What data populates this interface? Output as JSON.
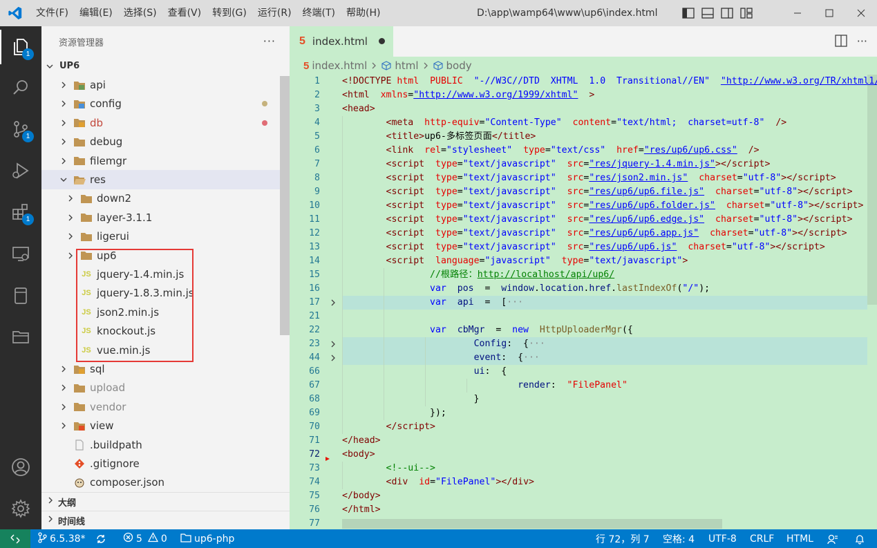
{
  "titlebar": {
    "menu": [
      "文件(F)",
      "编辑(E)",
      "选择(S)",
      "查看(V)",
      "转到(G)",
      "运行(R)",
      "终端(T)",
      "帮助(H)"
    ],
    "window_title": "D:\\app\\wamp64\\www\\up6\\index.html"
  },
  "activity": {
    "explorer_badge": "1",
    "scm_badge": "1",
    "extensions_badge": "1"
  },
  "sidebar": {
    "title": "资源管理器",
    "more": "···",
    "root": "UP6",
    "items": [
      {
        "label": "api",
        "depth": 1,
        "kind": "folder-special",
        "icon_color": "#6a9955"
      },
      {
        "label": "config",
        "depth": 1,
        "kind": "folder-special",
        "icon_color": "#4a90d9",
        "status": "#c5b27d"
      },
      {
        "label": "db",
        "depth": 1,
        "kind": "folder-special",
        "icon_color": "#e0a030",
        "status": "#e06c75",
        "text_color": "#c2473b"
      },
      {
        "label": "debug",
        "depth": 1,
        "kind": "folder"
      },
      {
        "label": "filemgr",
        "depth": 1,
        "kind": "folder"
      },
      {
        "label": "res",
        "depth": 1,
        "kind": "folder-open"
      },
      {
        "label": "down2",
        "depth": 2,
        "kind": "folder"
      },
      {
        "label": "layer-3.1.1",
        "depth": 2,
        "kind": "folder"
      },
      {
        "label": "ligerui",
        "depth": 2,
        "kind": "folder"
      },
      {
        "label": "up6",
        "depth": 2,
        "kind": "folder"
      },
      {
        "label": "jquery-1.4.min.js",
        "depth": 2,
        "kind": "js"
      },
      {
        "label": "jquery-1.8.3.min.js",
        "depth": 2,
        "kind": "js"
      },
      {
        "label": "json2.min.js",
        "depth": 2,
        "kind": "js"
      },
      {
        "label": "knockout.js",
        "depth": 2,
        "kind": "js"
      },
      {
        "label": "vue.min.js",
        "depth": 2,
        "kind": "js"
      },
      {
        "label": "sql",
        "depth": 1,
        "kind": "folder-special",
        "icon_color": "#e0a030"
      },
      {
        "label": "upload",
        "depth": 1,
        "kind": "folder",
        "text_color": "#8a8a8a"
      },
      {
        "label": "vendor",
        "depth": 1,
        "kind": "folder",
        "text_color": "#8a8a8a"
      },
      {
        "label": "view",
        "depth": 1,
        "kind": "folder-special",
        "icon_color": "#e44d26"
      },
      {
        "label": ".buildpath",
        "depth": 1,
        "kind": "file"
      },
      {
        "label": ".gitignore",
        "depth": 1,
        "kind": "git"
      },
      {
        "label": "composer.json",
        "depth": 1,
        "kind": "composer"
      }
    ],
    "outline_label": "大纲",
    "timeline_label": "时间线"
  },
  "editor": {
    "tab_label": "index.html",
    "breadcrumb": [
      "index.html",
      "html",
      "body"
    ],
    "line_numbers": [
      "1",
      "2",
      "3",
      "4",
      "5",
      "6",
      "7",
      "8",
      "9",
      "10",
      "11",
      "12",
      "13",
      "14",
      "15",
      "16",
      "17",
      "21",
      "22",
      "23",
      "44",
      "66",
      "67",
      "68",
      "69",
      "70",
      "71",
      "72",
      "73",
      "74",
      "75",
      "76",
      "77"
    ]
  },
  "statusbar": {
    "branch": "6.5.38*",
    "errors": "5",
    "warnings": "0",
    "folder": "up6-php",
    "position": "行 72，列 7",
    "spaces": "空格: 4",
    "encoding": "UTF-8",
    "eol": "CRLF",
    "language": "HTML"
  },
  "colors": {
    "editor_bg": "#c7edcc",
    "statusbar_bg": "#007acc",
    "activitybar_bg": "#2c2c2c",
    "highlight_box": "#e53935"
  }
}
